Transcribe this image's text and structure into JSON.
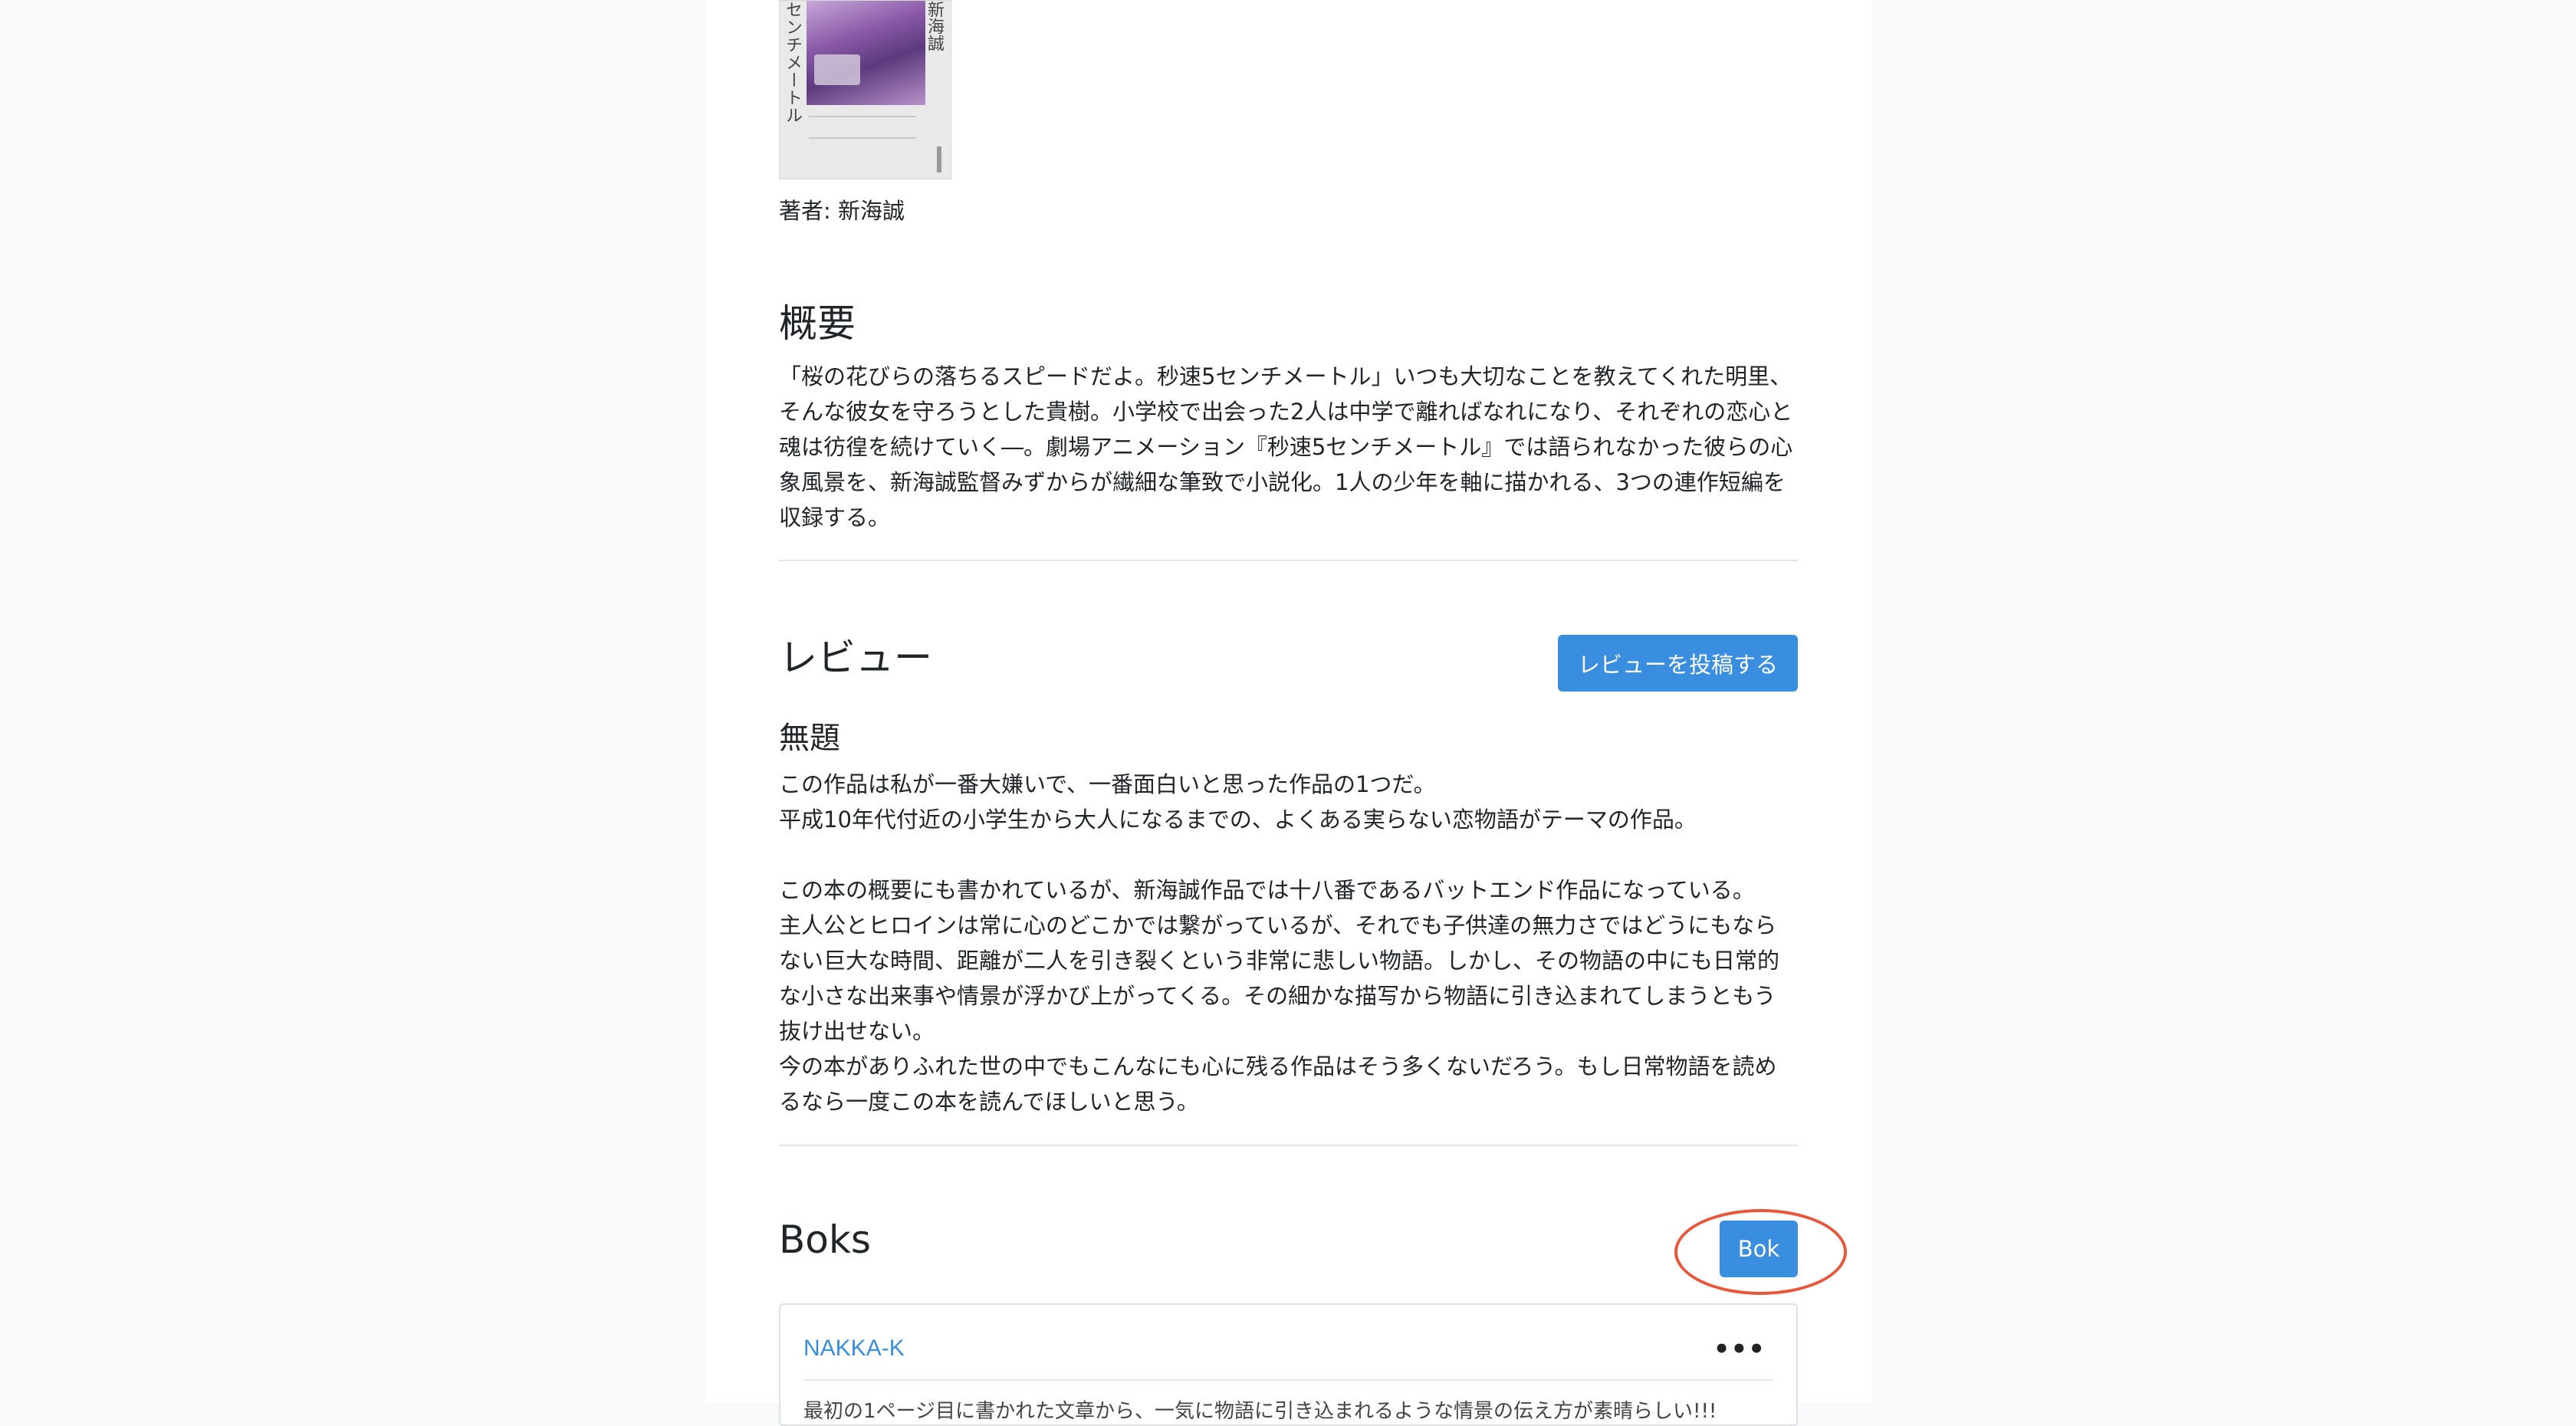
{
  "book": {
    "cover_title_vertical": "センチメートル",
    "cover_author_vertical": "新海誠",
    "author_line": "著者: 新海誠"
  },
  "summary": {
    "heading": "概要",
    "text": "「桜の花びらの落ちるスピードだよ。秒速5センチメートル」いつも大切なことを教えてくれた明里、そんな彼女を守ろうとした貴樹。小学校で出会った2人は中学で離ればなれになり、それぞれの恋心と魂は彷徨を続けていく―。劇場アニメーション『秒速5センチメートル』では語られなかった彼らの心象風景を、新海誠監督みずからが繊細な筆致で小説化。1人の少年を軸に描かれる、3つの連作短編を収録する。"
  },
  "reviews": {
    "heading": "レビュー",
    "post_button": "レビューを投稿する",
    "items": [
      {
        "title": "無題",
        "body": "この作品は私が一番大嫌いで、一番面白いと思った作品の1つだ。\n平成10年代付近の小学生から大人になるまでの、よくある実らない恋物語がテーマの作品。\n\nこの本の概要にも書かれているが、新海誠作品では十八番であるバットエンド作品になっている。\n主人公とヒロインは常に心のどこかでは繋がっているが、それでも子供達の無力さではどうにもならない巨大な時間、距離が二人を引き裂くという非常に悲しい物語。しかし、その物語の中にも日常的な小さな出来事や情景が浮かび上がってくる。その細かな描写から物語に引き込まれてしまうともう抜け出せない。\n今の本がありふれた世の中でもこんなにも心に残る作品はそう多くないだろう。もし日常物語を読めるなら一度この本を読んでほしいと思う。"
      }
    ]
  },
  "boks": {
    "heading": "Boks",
    "button": "Bok",
    "items": [
      {
        "user": "NAKKA-K",
        "menu": "•••",
        "snippet": "最初の1ページ目に書かれた文章から、一気に物語に引き込まれるような情景の伝え方が素晴らしい!!!"
      }
    ]
  },
  "colors": {
    "primary": "#3a8ee0",
    "highlight": "#e8573a",
    "background": "#f8f9fb"
  }
}
